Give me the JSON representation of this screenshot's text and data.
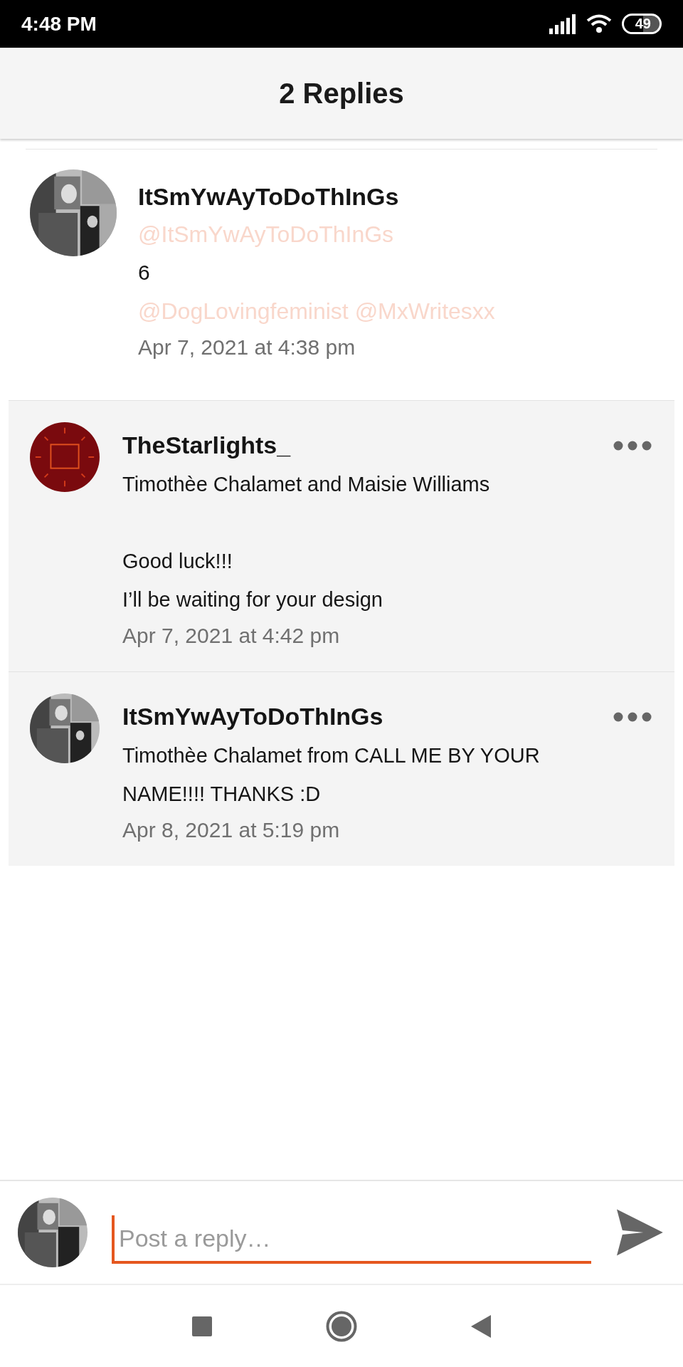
{
  "status_bar": {
    "time": "4:48 PM",
    "battery": "49"
  },
  "header": {
    "title": "2 Replies"
  },
  "parent_comment": {
    "author": "ItSmYwAyToDoThInGs",
    "handle": "@ItSmYwAyToDoThInGs",
    "text": "6",
    "mentions": "@DogLovingfeminist @MxWritesxx",
    "time": "Apr 7, 2021 at 4:38 pm"
  },
  "replies": [
    {
      "author": "TheStarlights_",
      "avatar": {
        "kind": "logo"
      },
      "text": "Timothèe Chalamet and Maisie Williams\n\nGood luck!!!\nI’ll be waiting for your design",
      "time": "Apr 7, 2021 at 4:42 pm"
    },
    {
      "author": "ItSmYwAyToDoThInGs",
      "text": "Timothèe Chalamet from CALL ME BY YOUR NAME!!!! THANKS :D",
      "time": "Apr 8, 2021 at 5:19 pm"
    }
  ],
  "composer": {
    "placeholder": "Post a reply…"
  }
}
